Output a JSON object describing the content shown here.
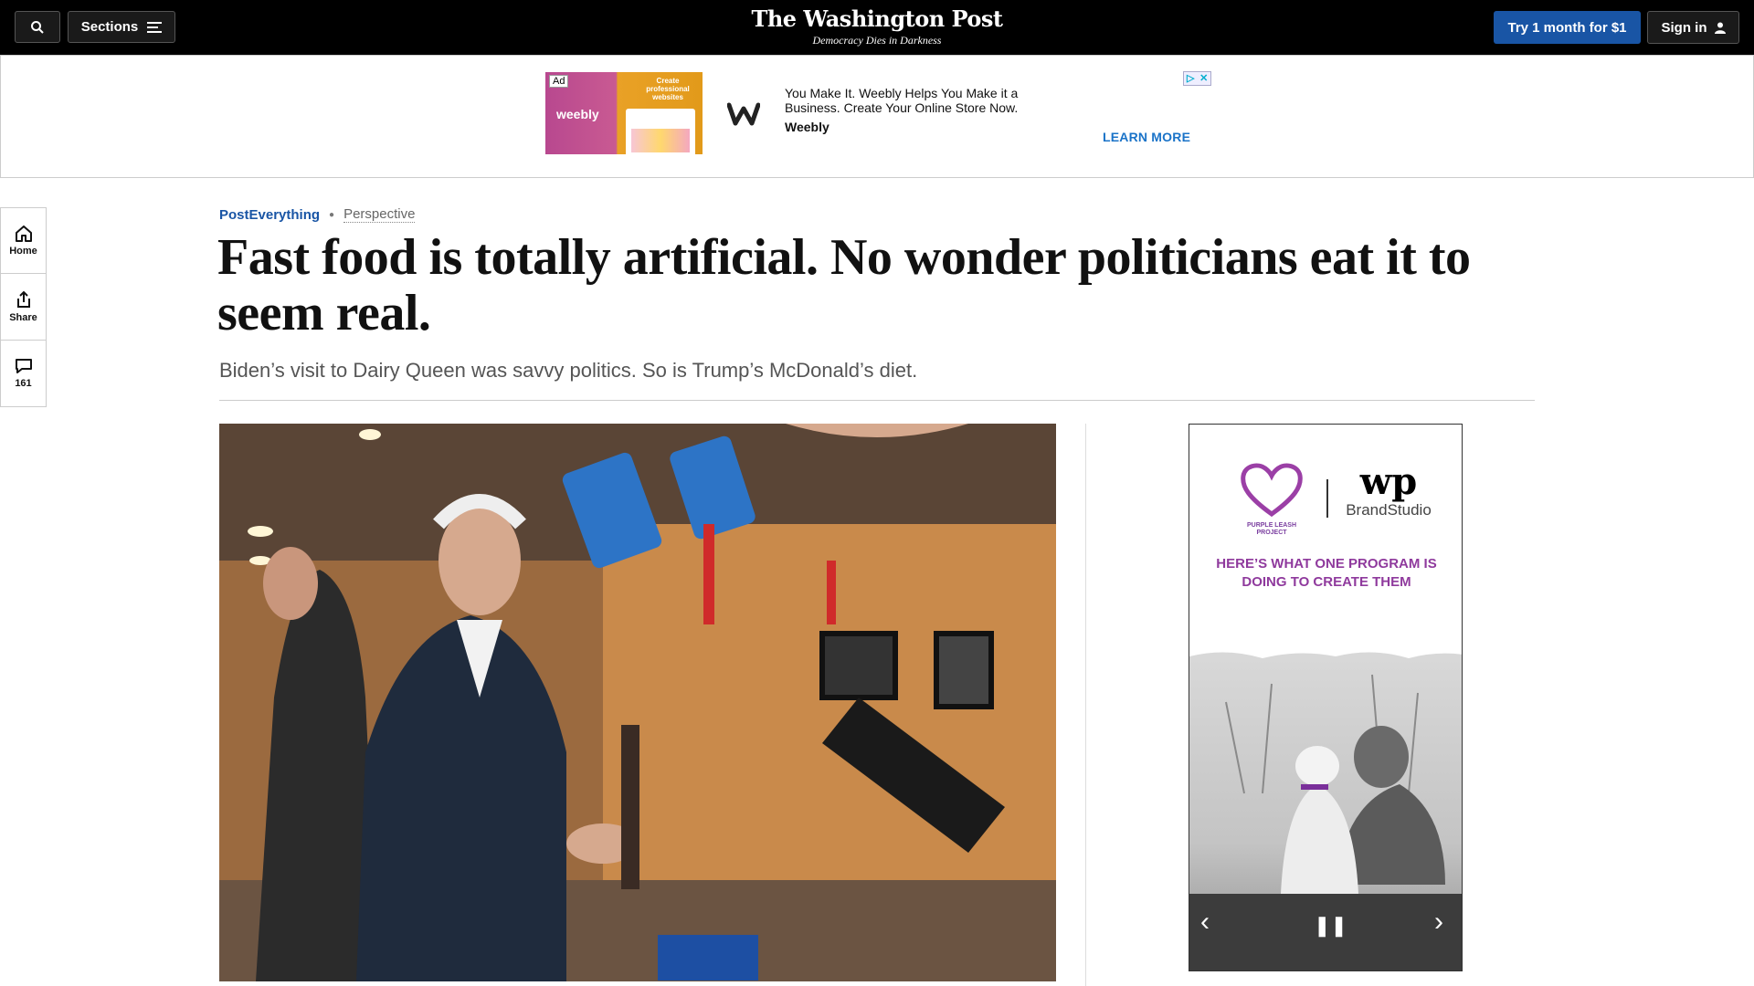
{
  "header": {
    "sections_label": "Sections",
    "logo_text": "The Washington Post",
    "tagline": "Democracy Dies in Darkness",
    "subscribe_label": "Try 1 month for $1",
    "signin_label": "Sign in"
  },
  "top_ad": {
    "ad_badge": "Ad",
    "thumb_brand": "weebly",
    "thumb_headline": "Create professional websites",
    "text": "You Make It. Weebly Helps You Make it a Business. Create Your Online Store Now.",
    "brand": "Weebly",
    "cta": "LEARN MORE"
  },
  "rail": {
    "home_label": "Home",
    "share_label": "Share",
    "comments_count": "161"
  },
  "article": {
    "section": "PostEverything",
    "label": "Perspective",
    "headline": "Fast food is totally artificial. No wonder politicians eat it to seem real.",
    "dek": "Biden’s visit to Dairy Queen was savvy politics. So is Trump’s McDonald’s diet."
  },
  "side_ad": {
    "sponsor_name": "PURPLE LEASH PROJECT",
    "wp_mark": "wp",
    "studio": "BrandStudio",
    "message": "HERE’S WHAT ONE PROGRAM IS DOING TO CREATE THEM"
  },
  "colors": {
    "topbar": "#000000",
    "accent_blue": "#1955a5",
    "ad_link": "#1a73c8",
    "ad_purple": "#8f3a9d"
  }
}
